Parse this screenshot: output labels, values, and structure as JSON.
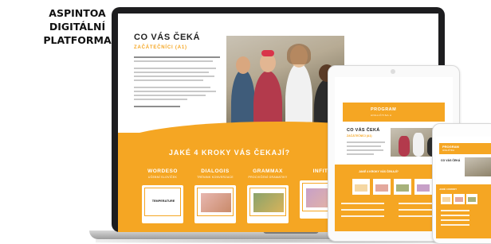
{
  "brand": {
    "lines": [
      "ASPINTOA",
      "DIGITÁLNÍ",
      "PLATFORMA"
    ]
  },
  "laptop_page": {
    "heading": "CO VÁS ČEKÁ",
    "subheading": "ZAČÁTEČNÍCI (A1)",
    "steps_heading": "JAKÉ 4 KROKY VÁS ČEKAJÍ?",
    "steps": [
      {
        "title": "WORDESO",
        "subtitle": "UČEBNÍ SLOVÍČEK",
        "card_label": "TEMPERATURE"
      },
      {
        "title": "DIALOGIS",
        "subtitle": "TRÉNINK KONVERZACE",
        "card_label": ""
      },
      {
        "title": "GRAMMAX",
        "subtitle": "PROCVIČENÍ GRAMATIKY",
        "card_label": ""
      },
      {
        "title": "INFIT",
        "subtitle": "",
        "card_label": ""
      }
    ]
  },
  "tablet_page": {
    "banner_title": "PROGRAM",
    "banner_subtitle": "ANGLIČTINA A",
    "heading": "CO VÁS ČEKÁ",
    "subheading": "ZAČÁTEČNÍCI (A1)",
    "steps_heading": "JAKÉ 4 KROKY VÁS ČEKAJÍ?"
  },
  "phone_page": {
    "banner_title": "PROGRAM",
    "banner_subtitle": "ANGLIČTINA",
    "heading": "CO VÁS ČEKÁ",
    "steps_heading": "JAKÉ 4 KROKY"
  },
  "colors": {
    "accent": "#f5a623",
    "device_dark": "#1d1d1f",
    "text": "#222222"
  }
}
